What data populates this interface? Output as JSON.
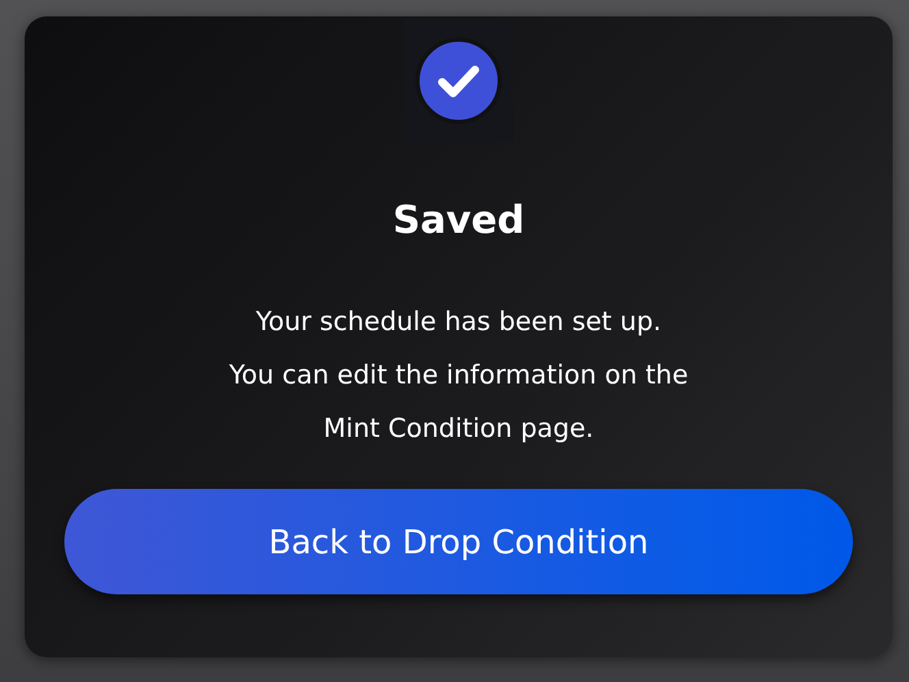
{
  "dialog": {
    "title": "Saved",
    "message_lines": [
      "Your schedule has been set up.",
      "You can edit the information on the",
      "Mint Condition page."
    ],
    "button": "Back to Drop Condition"
  }
}
